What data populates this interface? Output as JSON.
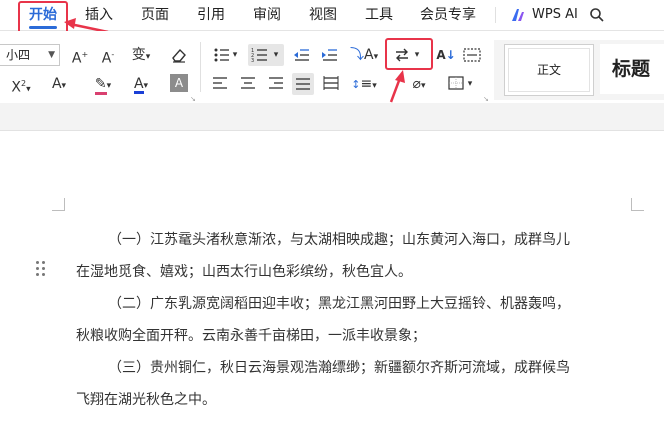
{
  "tabs": [
    {
      "label": "开始"
    },
    {
      "label": "插入"
    },
    {
      "label": "页面"
    },
    {
      "label": "引用"
    },
    {
      "label": "审阅"
    },
    {
      "label": "视图"
    },
    {
      "label": "工具"
    },
    {
      "label": "会员专享"
    }
  ],
  "wps_ai": {
    "label": "WPS AI"
  },
  "ribbon": {
    "font_size": "小四",
    "text_color": "#1a3fd6",
    "style_normal": "正文",
    "style_heading": "标题"
  },
  "annotations": {
    "highlight_color": "#e8344a"
  },
  "document": {
    "paragraphs": [
      {
        "line1": "（一）江苏鼋头渚秋意渐浓，与太湖相映成趣；山东黄河入海口，成群鸟儿",
        "line2": "在湿地觅食、嬉戏；山西太行山色彩缤纷，秋色宜人。"
      },
      {
        "line1": "（二）广东乳源宽阔稻田迎丰收；黑龙江黑河田野上大豆摇铃、机器轰鸣，",
        "line2": "秋粮收购全面开秤。云南永善千亩梯田，一派丰收景象；"
      },
      {
        "line1": "（三）贵州铜仁，秋日云海景观浩瀚缥缈；新疆额尔齐斯河流域，成群候鸟",
        "line2": "飞翔在湖光秋色之中。"
      }
    ]
  }
}
